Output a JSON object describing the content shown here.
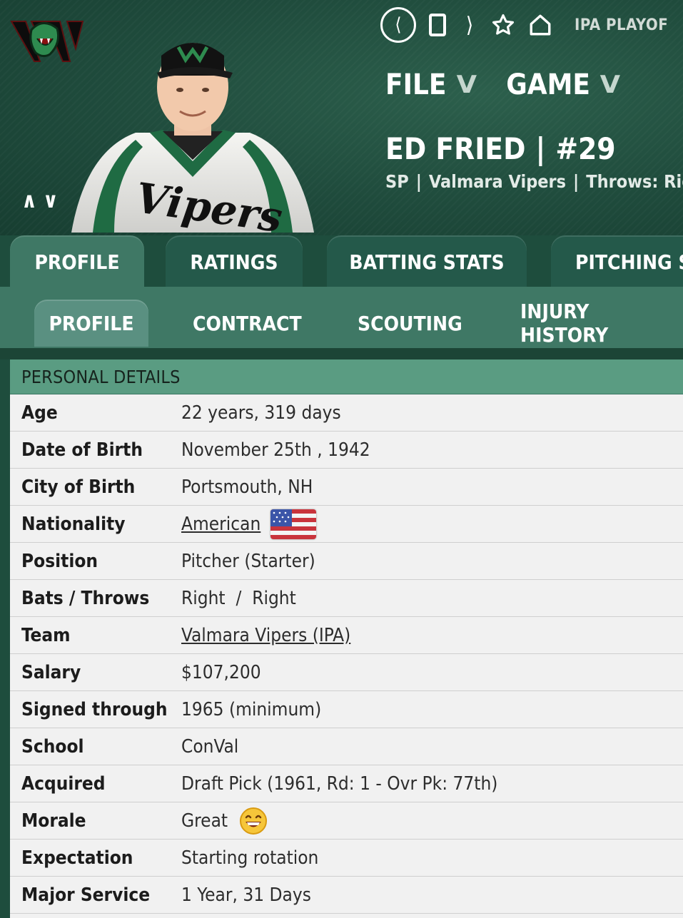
{
  "nav": {
    "league_label": "IPA PLAYOF",
    "menus": [
      {
        "label": "FILE"
      },
      {
        "label": "GAME"
      }
    ]
  },
  "player": {
    "name": "ED FRIED",
    "number": "#29",
    "position": "SP",
    "team": "Valmara Vipers",
    "throws_label": "Throws: Rig"
  },
  "tabs_primary": [
    {
      "label": "PROFILE",
      "active": true
    },
    {
      "label": "RATINGS"
    },
    {
      "label": "BATTING STATS"
    },
    {
      "label": "PITCHING S"
    }
  ],
  "tabs_secondary": [
    {
      "label": "PROFILE",
      "active": true
    },
    {
      "label": "CONTRACT"
    },
    {
      "label": "SCOUTING"
    },
    {
      "label": "INJURY HISTORY"
    }
  ],
  "section": {
    "title": "PERSONAL DETAILS",
    "rows": [
      {
        "label": "Age",
        "value": "22 years, 319 days"
      },
      {
        "label": "Date of Birth",
        "value": "November 25th , 1942"
      },
      {
        "label": "City of Birth",
        "value": "Portsmouth, NH"
      },
      {
        "label": "Nationality",
        "value": "American",
        "link": true,
        "icon": "us-flag-icon"
      },
      {
        "label": "Position",
        "value": "Pitcher (Starter)"
      },
      {
        "label": "Bats / Throws",
        "value": "Right  /  Right"
      },
      {
        "label": "Team",
        "value": "Valmara Vipers (IPA)",
        "link": true
      },
      {
        "label": "Salary",
        "value": "$107,200"
      },
      {
        "label": "Signed through",
        "value": "1965 (minimum)"
      },
      {
        "label": "School",
        "value": "ConVal"
      },
      {
        "label": "Acquired",
        "value": "Draft Pick (1961, Rd: 1 - Ovr Pk: 77th)"
      },
      {
        "label": "Morale",
        "value": "Great",
        "icon": "grinning-face-icon"
      },
      {
        "label": "Expectation",
        "value": "Starting rotation"
      },
      {
        "label": "Major Service",
        "value": "1 Year, 31 Days"
      }
    ]
  },
  "logo": {
    "text": "VV"
  },
  "jersey": {
    "text": "Vipers"
  },
  "colors": {
    "brand_green": "#1f4b3c",
    "tab_active": "#3f7865",
    "header_row": "#5a9c82",
    "accent_green": "#2e8b4f"
  }
}
